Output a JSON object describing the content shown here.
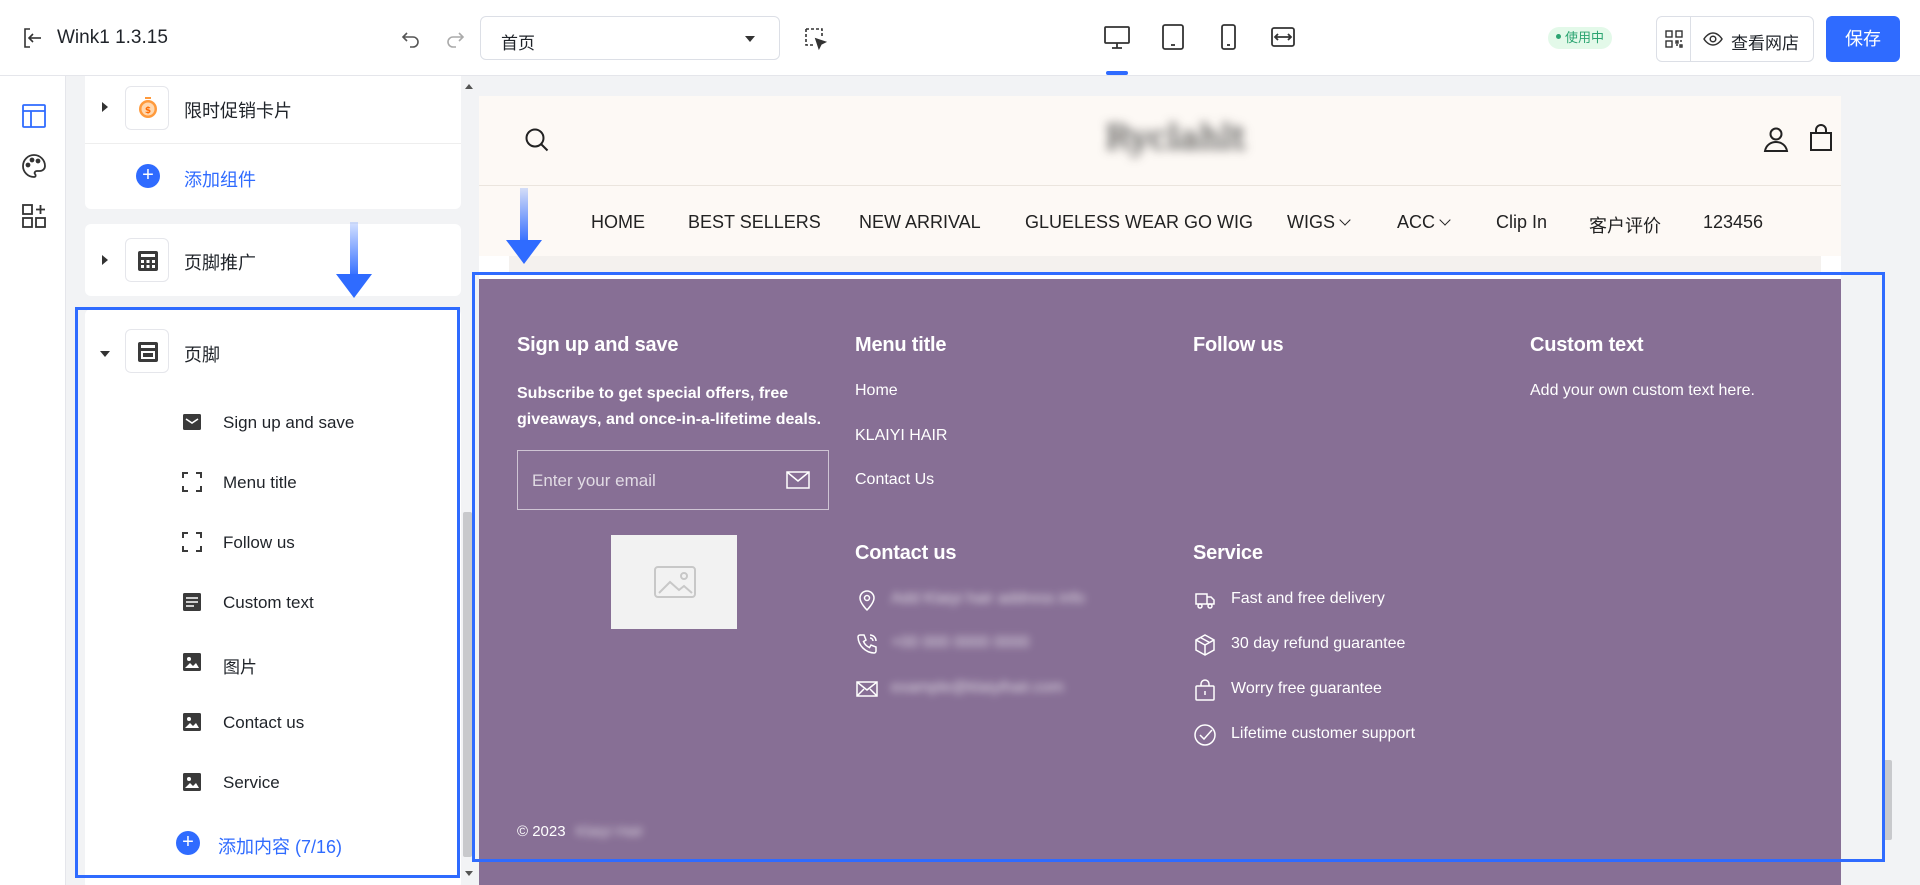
{
  "topbar": {
    "app_name": "Wink1  1.3.15",
    "page_select_value": "首页",
    "status_badge": "使用中",
    "view_store": "查看网店",
    "save": "保存"
  },
  "panel": {
    "card1": {
      "label": "限时促销卡片",
      "add": "添加组件"
    },
    "card2": {
      "label": "页脚推广"
    },
    "card3": {
      "label": "页脚",
      "items": [
        {
          "label": "Sign up and save",
          "icon": "email-block-icon"
        },
        {
          "label": "Menu title",
          "icon": "frame-corners-icon"
        },
        {
          "label": "Follow us",
          "icon": "frame-corners-icon"
        },
        {
          "label": "Custom text",
          "icon": "text-lines-icon"
        },
        {
          "label": "图片",
          "icon": "image-icon"
        },
        {
          "label": "Contact us",
          "icon": "image-icon"
        },
        {
          "label": "Service",
          "icon": "image-icon"
        }
      ],
      "add": "添加内容 (7/16)"
    }
  },
  "store": {
    "logo": "Ryclahlt",
    "nav": [
      "HOME",
      "BEST SELLERS",
      "NEW ARRIVAL",
      "GLUELESS WEAR GO WIG",
      "WIGS",
      "ACC",
      "Clip In",
      "客户评价",
      "123456"
    ]
  },
  "footer": {
    "signup": {
      "title": "Sign up and save",
      "desc": "Subscribe to get special offers, free giveaways, and once-in-a-lifetime deals.",
      "placeholder": "Enter your email"
    },
    "menu": {
      "title": "Menu title",
      "links": [
        "Home",
        "KLAIYI HAIR",
        "Contact Us"
      ]
    },
    "follow": {
      "title": "Follow us"
    },
    "custom": {
      "title": "Custom text",
      "text": "Add your own custom text here."
    },
    "contact": {
      "title": "Contact us",
      "lines": [
        "Add Klaiyi hair address info",
        "+00 000 0000 0000",
        "example@klaiyihair.com"
      ]
    },
    "service": {
      "title": "Service",
      "items": [
        "Fast and free delivery",
        "30 day refund guarantee",
        "Worry free guarantee",
        "Lifetime customer support"
      ]
    },
    "copyright": "© 2023",
    "copyright_owner": "Klaiyi Hair"
  },
  "colors": {
    "accent": "#2f6bff",
    "footer_bg": "#876f95",
    "header_bg": "#fdf9f5",
    "badge_green": "#2ba471"
  }
}
